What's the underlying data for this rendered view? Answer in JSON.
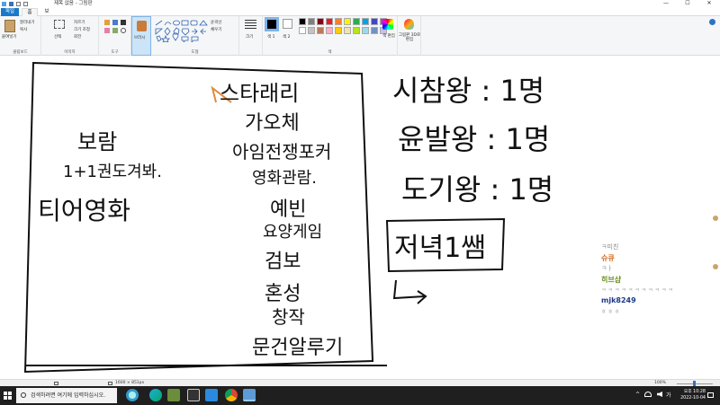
{
  "window": {
    "title": "제목 없음 - 그림판",
    "minimize": "—",
    "maximize": "☐",
    "close": "✕"
  },
  "tabs": {
    "file": "파일",
    "home": "홈",
    "view": "보기"
  },
  "ribbon": {
    "clipboard": {
      "label": "클립보드",
      "paste": "붙여넣기",
      "cut": "잘라내기",
      "copy": "복사"
    },
    "image": {
      "label": "이미지",
      "select": "선택",
      "crop": "자르기",
      "resize": "크기 조정",
      "rotate": "회전"
    },
    "tools": {
      "label": "도구",
      "brush": "브러시"
    },
    "shapes": {
      "label": "도형",
      "outline": "윤곽선",
      "fill": "채우기"
    },
    "size": {
      "label": "크기"
    },
    "colors": {
      "label": "색",
      "color1": "색 1",
      "color2": "색 2",
      "edit": "색 편집",
      "paint3d": "그림판 3D로 편집",
      "palette": [
        "#000000",
        "#7f7f7f",
        "#880015",
        "#ed1c24",
        "#ff7f27",
        "#fff200",
        "#22b14c",
        "#00a2e8",
        "#3f48cc",
        "#a349a4",
        "#ffffff",
        "#c3c3c3",
        "#b97a57",
        "#ffaec9",
        "#ffc90e",
        "#efe4b0",
        "#b5e61d",
        "#99d9ea",
        "#7092be",
        "#c8bfe7"
      ]
    }
  },
  "canvas_text": {
    "left_box": [
      "보람",
      "1+1권도겨봐.",
      "티어영화"
    ],
    "middle": [
      "스타래리",
      "가오체",
      "아임전쟁포커",
      "영화관람.",
      "예빈",
      "요양게임",
      "검보",
      "혼성",
      "창작",
      "문건알루기"
    ],
    "right": [
      "시참왕 : 1명",
      "윤발왕 : 1명",
      "도기왕 : 1명"
    ],
    "boxed": "저녁1쌤"
  },
  "chat": {
    "lines": [
      {
        "text": "ㅋ미친",
        "color": "#888888"
      },
      {
        "text": "슈큐",
        "color": "#d2691e"
      },
      {
        "text": "ㅋㅏ",
        "color": "#999999"
      },
      {
        "text": "히브샵",
        "color": "#6b8e23"
      },
      {
        "text": "ㅋ ㅋ ㅋ ㅋ ㅋ ㅋ ㅋ ㅋ ㅋ ㅋ ㅋ",
        "color": "#aaaaaa"
      },
      {
        "text": "mjk8249",
        "color": "#1e3a8a"
      },
      {
        "text": "ㅎ ㅎ ㅎ",
        "color": "#999999"
      }
    ]
  },
  "status": {
    "dims": "1600 × 851px",
    "zoom": "100%"
  },
  "taskbar": {
    "search_placeholder": "검색하려면 여기에 입력하십시오.",
    "time": "오후 10:28",
    "date": "2022-10-04"
  }
}
